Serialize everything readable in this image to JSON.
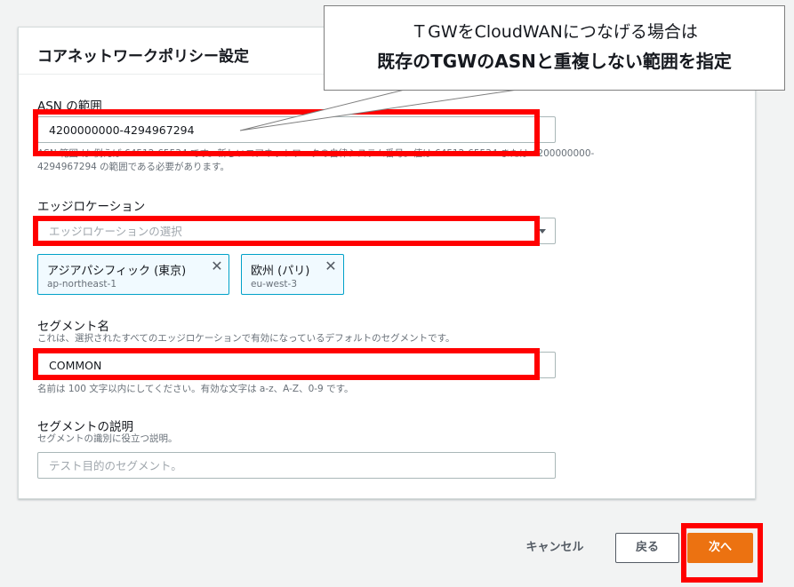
{
  "panel": {
    "title": "コアネットワークポリシー設定"
  },
  "asn": {
    "label": "ASN の範囲",
    "value": "4200000000-4294967294",
    "description_line1": "ASN 範囲 は 例えば 64512-65534 です。新しいコアネットワークの自律システム番号。値は 64512-65534 または 4200000000-",
    "description_line2": "4294967294 の範囲である必要があります。"
  },
  "edge": {
    "label": "エッジロケーション",
    "placeholder": "エッジロケーションの選択",
    "tokens": [
      {
        "name": "アジアパシフィック (東京)",
        "region": "ap-northeast-1"
      },
      {
        "name": "欧州 (パリ)",
        "region": "eu-west-3"
      }
    ]
  },
  "segment": {
    "label": "セグメント名",
    "description": "これは、選択されたすべてのエッジロケーションで有効になっているデフォルトのセグメントです。",
    "value": "COMMON",
    "hint": "名前は 100 文字以内にしてください。有効な文字は a-z、A-Z、0-9 です。"
  },
  "segment_desc": {
    "label": "セグメントの説明",
    "description": "セグメントの識別に役立つ説明。",
    "placeholder": "テスト目的のセグメント。"
  },
  "callout": {
    "line1": "ＴGWをCloudWANにつなげる場合は",
    "line2": "既存のTGWのASNと重複しない範囲を指定"
  },
  "actions": {
    "cancel": "キャンセル",
    "back": "戻る",
    "next": "次へ"
  },
  "colors": {
    "highlight": "#ff0000",
    "primary": "#ec7211",
    "token_border": "#00a1c9"
  }
}
